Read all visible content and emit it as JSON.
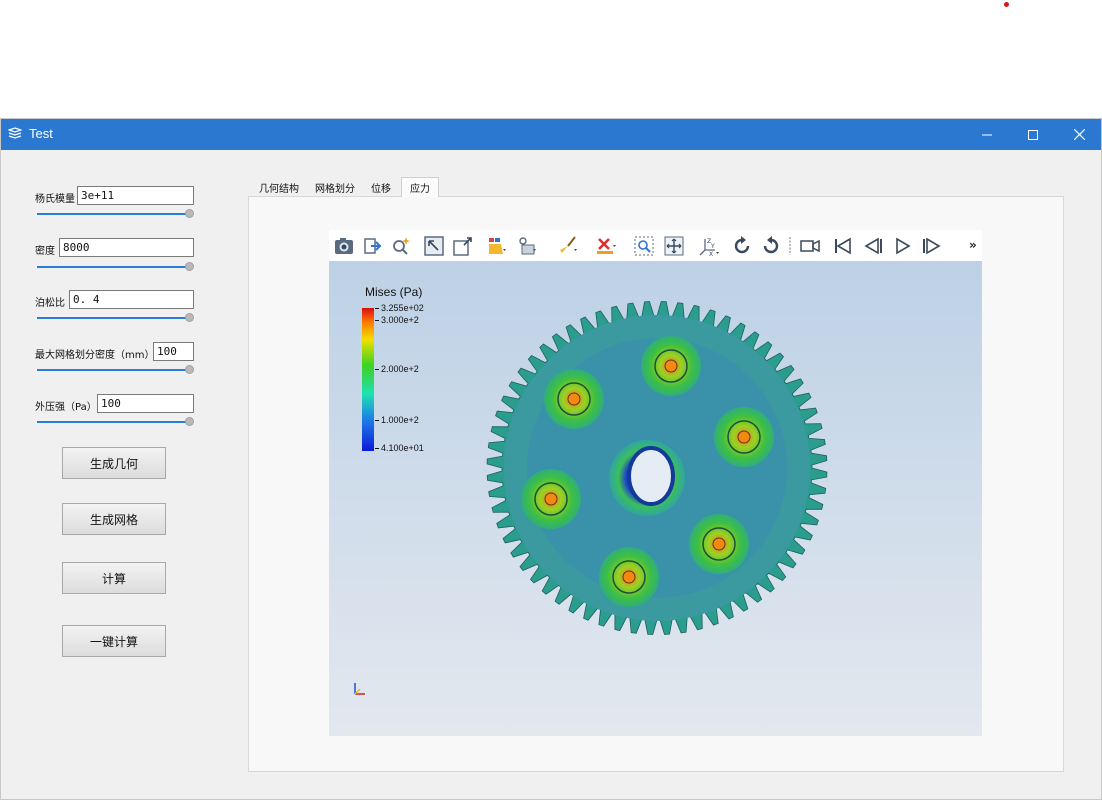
{
  "window": {
    "title": "Test"
  },
  "params": {
    "youngs_modulus": {
      "label": "杨氏模量",
      "value": "3e+11"
    },
    "density": {
      "label": "密度",
      "value": "8000"
    },
    "poisson_ratio": {
      "label": "泊松比",
      "value": "0. 4"
    },
    "max_mesh_density": {
      "label": "最大网格划分密度（mm）",
      "value": "100"
    },
    "external_pressure": {
      "label": "外压强（Pa）",
      "value": "100"
    }
  },
  "buttons": {
    "generate_geometry": "生成几何",
    "generate_mesh": "生成网格",
    "compute": "计算",
    "one_click_compute": "一键计算"
  },
  "tabs": [
    {
      "label": "几何结构",
      "active": false
    },
    {
      "label": "网格划分",
      "active": false
    },
    {
      "label": "位移",
      "active": false
    },
    {
      "label": "应力",
      "active": true
    }
  ],
  "viewer": {
    "colorbar_title": "Mises (Pa)",
    "colorbar_labels": [
      "3.255e+02",
      "3.000e+2",
      "2.000e+2",
      "1.000e+2",
      "4.100e+01"
    ],
    "toolbar_more": "»"
  },
  "colors": {
    "accent": "#2b78d0",
    "slider": "#2a7bd4"
  }
}
